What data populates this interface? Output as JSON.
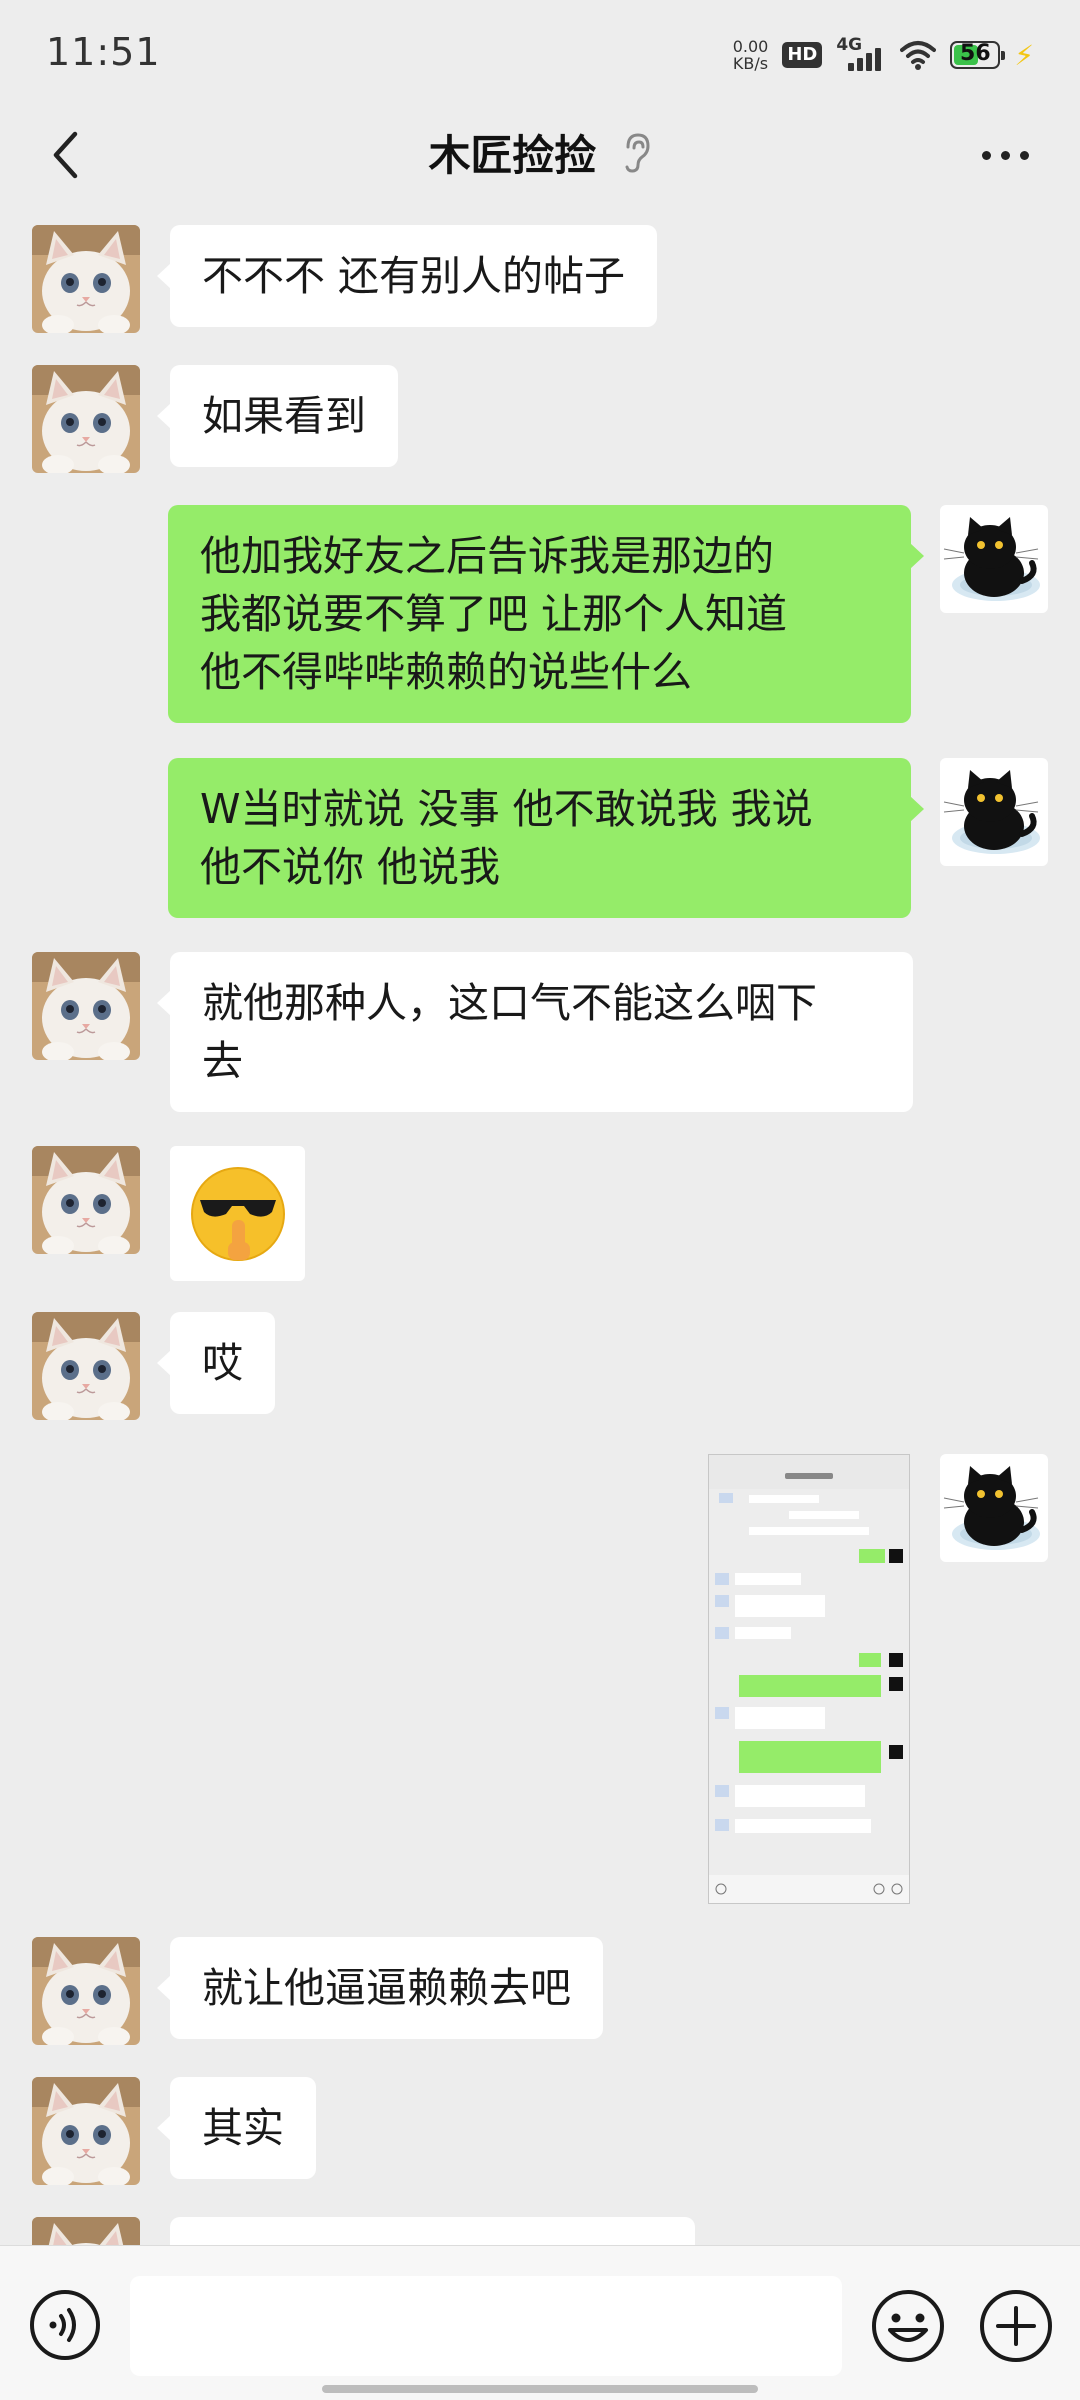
{
  "status_bar": {
    "time": "11:51",
    "net_speed_value": "0.00",
    "net_speed_unit": "KB/s",
    "hd_label": "HD",
    "network_label": "4G",
    "battery_level": "56",
    "battery_percent": 56,
    "battery_color": "#3bc24a"
  },
  "header": {
    "title": "木匠捡捡",
    "back_icon": "chevron-left-icon",
    "ear_icon": "ear-icon",
    "more_icon": "more-dots-icon"
  },
  "messages": [
    {
      "side": "in",
      "text": "不不不 还有别人的帖子"
    },
    {
      "side": "in",
      "text": "如果看到"
    },
    {
      "side": "out",
      "text": "他加我好友之后告诉我是那边的\n我都说要不算了吧 让那个人知道\n他不得哔哔赖赖的说些什么"
    },
    {
      "side": "out",
      "text": "W当时就说 没事 他不敢说我 我说\n他不说你 他说我"
    },
    {
      "side": "in",
      "text": "就他那种人，这口气不能这么咽下\n去"
    },
    {
      "side": "in",
      "type": "emoji",
      "emoji": "sunglasses-shush-emoji"
    },
    {
      "side": "in",
      "text": "哎"
    },
    {
      "side": "out",
      "type": "image",
      "description": "chat-screenshot-thumbnail"
    },
    {
      "side": "in",
      "text": "就让他逼逼赖赖去吧"
    },
    {
      "side": "in",
      "text": "其实"
    }
  ],
  "input_bar": {
    "placeholder": "",
    "voice_icon": "voice-icon",
    "emoji_icon": "emoji-smile-icon",
    "plus_icon": "plus-circle-icon"
  },
  "colors": {
    "background": "#ededed",
    "bubble_out": "#95ec69",
    "bubble_in": "#ffffff"
  }
}
